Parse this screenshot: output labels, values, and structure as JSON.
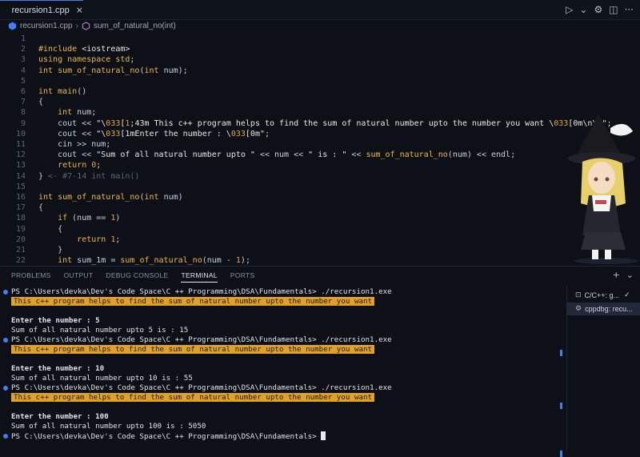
{
  "tab": {
    "filename": "recursion1.cpp",
    "close": "×"
  },
  "toolbar": {
    "run": "▷",
    "dropdown": "⌄",
    "gear": "⚙",
    "split": "◫",
    "more": "···"
  },
  "breadcrumb": {
    "file": "recursion1.cpp",
    "separator": "›",
    "symbol": "sum_of_natural_no(int)"
  },
  "editor": {
    "line_numbers": [
      "1",
      "2",
      "3",
      "4",
      "5",
      "6",
      "7",
      "8",
      "9",
      "10",
      "11",
      "12",
      "13",
      "14",
      "15",
      "16",
      "17",
      "18",
      "19",
      "20",
      "21",
      "22"
    ],
    "lines": [
      "",
      "#include <iostream>",
      "using namespace std;",
      "int sum_of_natural_no(int num);",
      "",
      "int main()",
      "{",
      "    int num;",
      "    cout << \"\\033[1;43m This c++ program helps to find the sum of natural number upto the number you want \\033[0m\\n\\n\";",
      "    cout << \"\\033[1mEnter the number : \\033[0m\";",
      "    cin >> num;",
      "    cout << \"Sum of all natural number upto \" << num << \" is : \" << sum_of_natural_no(num) << endl;",
      "    return 0;",
      "} <- #7-14 int main()",
      "",
      "int sum_of_natural_no(int num)",
      "{",
      "    if (num == 1)",
      "    {",
      "        return 1;",
      "    }",
      "    int sum_1m = sum_of_natural_no(num - 1);"
    ]
  },
  "panel": {
    "tabs": [
      "PROBLEMS",
      "OUTPUT",
      "DEBUG CONSOLE",
      "TERMINAL",
      "PORTS"
    ],
    "actions": {
      "add": "+",
      "dropdown": "⌄"
    }
  },
  "terminal": {
    "lines": [
      {
        "text": "PS C:\\Users\\devka\\Dev's Code Space\\C ++ Programming\\DSA\\Fundamentals> ./recursion1.exe",
        "style": "prompt"
      },
      {
        "text": "This c++ program helps to find the sum of natural number upto the number you want",
        "style": "highlight"
      },
      {
        "text": "",
        "style": "plain"
      },
      {
        "text": "Enter the number : 5",
        "style": "bold"
      },
      {
        "text": "Sum of all natural number upto 5 is : 15",
        "style": "plain"
      },
      {
        "text": "PS C:\\Users\\devka\\Dev's Code Space\\C ++ Programming\\DSA\\Fundamentals> ./recursion1.exe",
        "style": "prompt"
      },
      {
        "text": "This c++ program helps to find the sum of natural number upto the number you want",
        "style": "highlight"
      },
      {
        "text": "",
        "style": "plain"
      },
      {
        "text": "Enter the number : 10",
        "style": "bold"
      },
      {
        "text": "Sum of all natural number upto 10 is : 55",
        "style": "plain"
      },
      {
        "text": "PS C:\\Users\\devka\\Dev's Code Space\\C ++ Programming\\DSA\\Fundamentals> ./recursion1.exe",
        "style": "prompt"
      },
      {
        "text": "This c++ program helps to find the sum of natural number upto the number you want",
        "style": "highlight"
      },
      {
        "text": "",
        "style": "plain"
      },
      {
        "text": "Enter the number : 100",
        "style": "bold"
      },
      {
        "text": "Sum of all natural number upto 100 is : 5050",
        "style": "plain"
      },
      {
        "text": "PS C:\\Users\\devka\\Dev's Code Space\\C ++ Programming\\DSA\\Fundamentals> ",
        "style": "cursor"
      }
    ]
  },
  "sessions": [
    {
      "icon": "⊡",
      "label": "C/C++: g...",
      "check": "✓",
      "selected": false
    },
    {
      "icon": "⚙",
      "label": "cppdbg: recu...",
      "check": "",
      "selected": true
    }
  ],
  "colors": {
    "accent": "#3b82f6",
    "highlight_bg": "#e0a126",
    "keyword": "#f0b84a",
    "background": "#0d1017"
  }
}
